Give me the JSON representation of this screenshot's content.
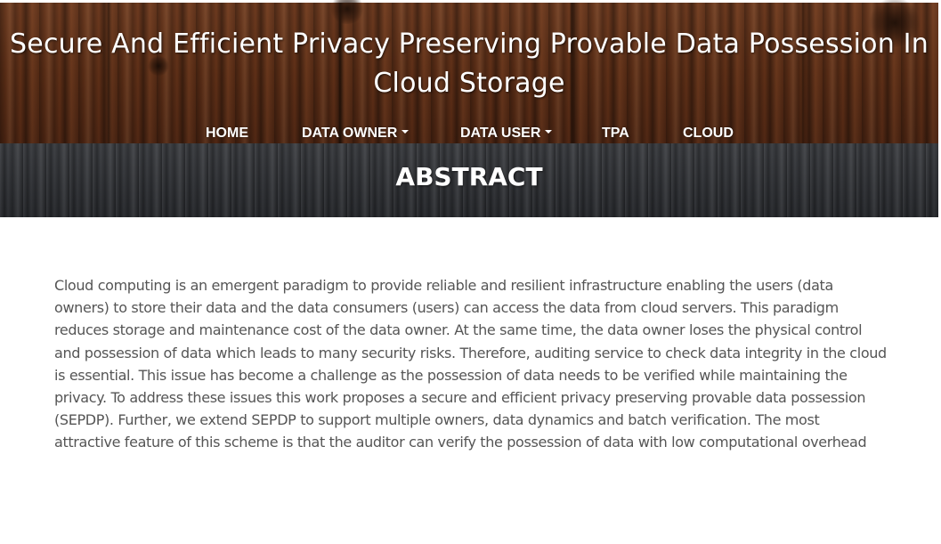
{
  "header": {
    "title": "Secure And Efficient Privacy Preserving Provable Data Possession In Cloud Storage"
  },
  "nav": {
    "items": [
      {
        "label": "HOME",
        "dropdown": false
      },
      {
        "label": "DATA OWNER",
        "dropdown": true
      },
      {
        "label": "DATA USER",
        "dropdown": true
      },
      {
        "label": "TPA",
        "dropdown": false
      },
      {
        "label": "CLOUD",
        "dropdown": false
      }
    ]
  },
  "banner": {
    "title": "ABSTRACT"
  },
  "content": {
    "abstract": "Cloud computing is an emergent paradigm to provide reliable and resilient infrastructure enabling the users (data owners) to store their data and the data consumers (users) can access the data from cloud servers. This paradigm reduces storage and maintenance cost of the data owner. At the same time, the data owner loses the physical control and possession of data which leads to many security risks. Therefore, auditing service to check data integrity in the cloud is essential. This issue has become a challenge as the possession of data needs to be verified while maintaining the privacy. To address these issues this work proposes a secure and efficient privacy preserving provable data possession (SEPDP). Further, we extend SEPDP to support multiple owners, data dynamics and batch verification. The most attractive feature of this scheme is that the auditor can verify the possession of data with low computational overhead"
  },
  "colors": {
    "header_wood": "#5a2f1a",
    "banner_dark": "#2b2d31",
    "nav_text": "#ffffff",
    "body_text": "#555555"
  }
}
